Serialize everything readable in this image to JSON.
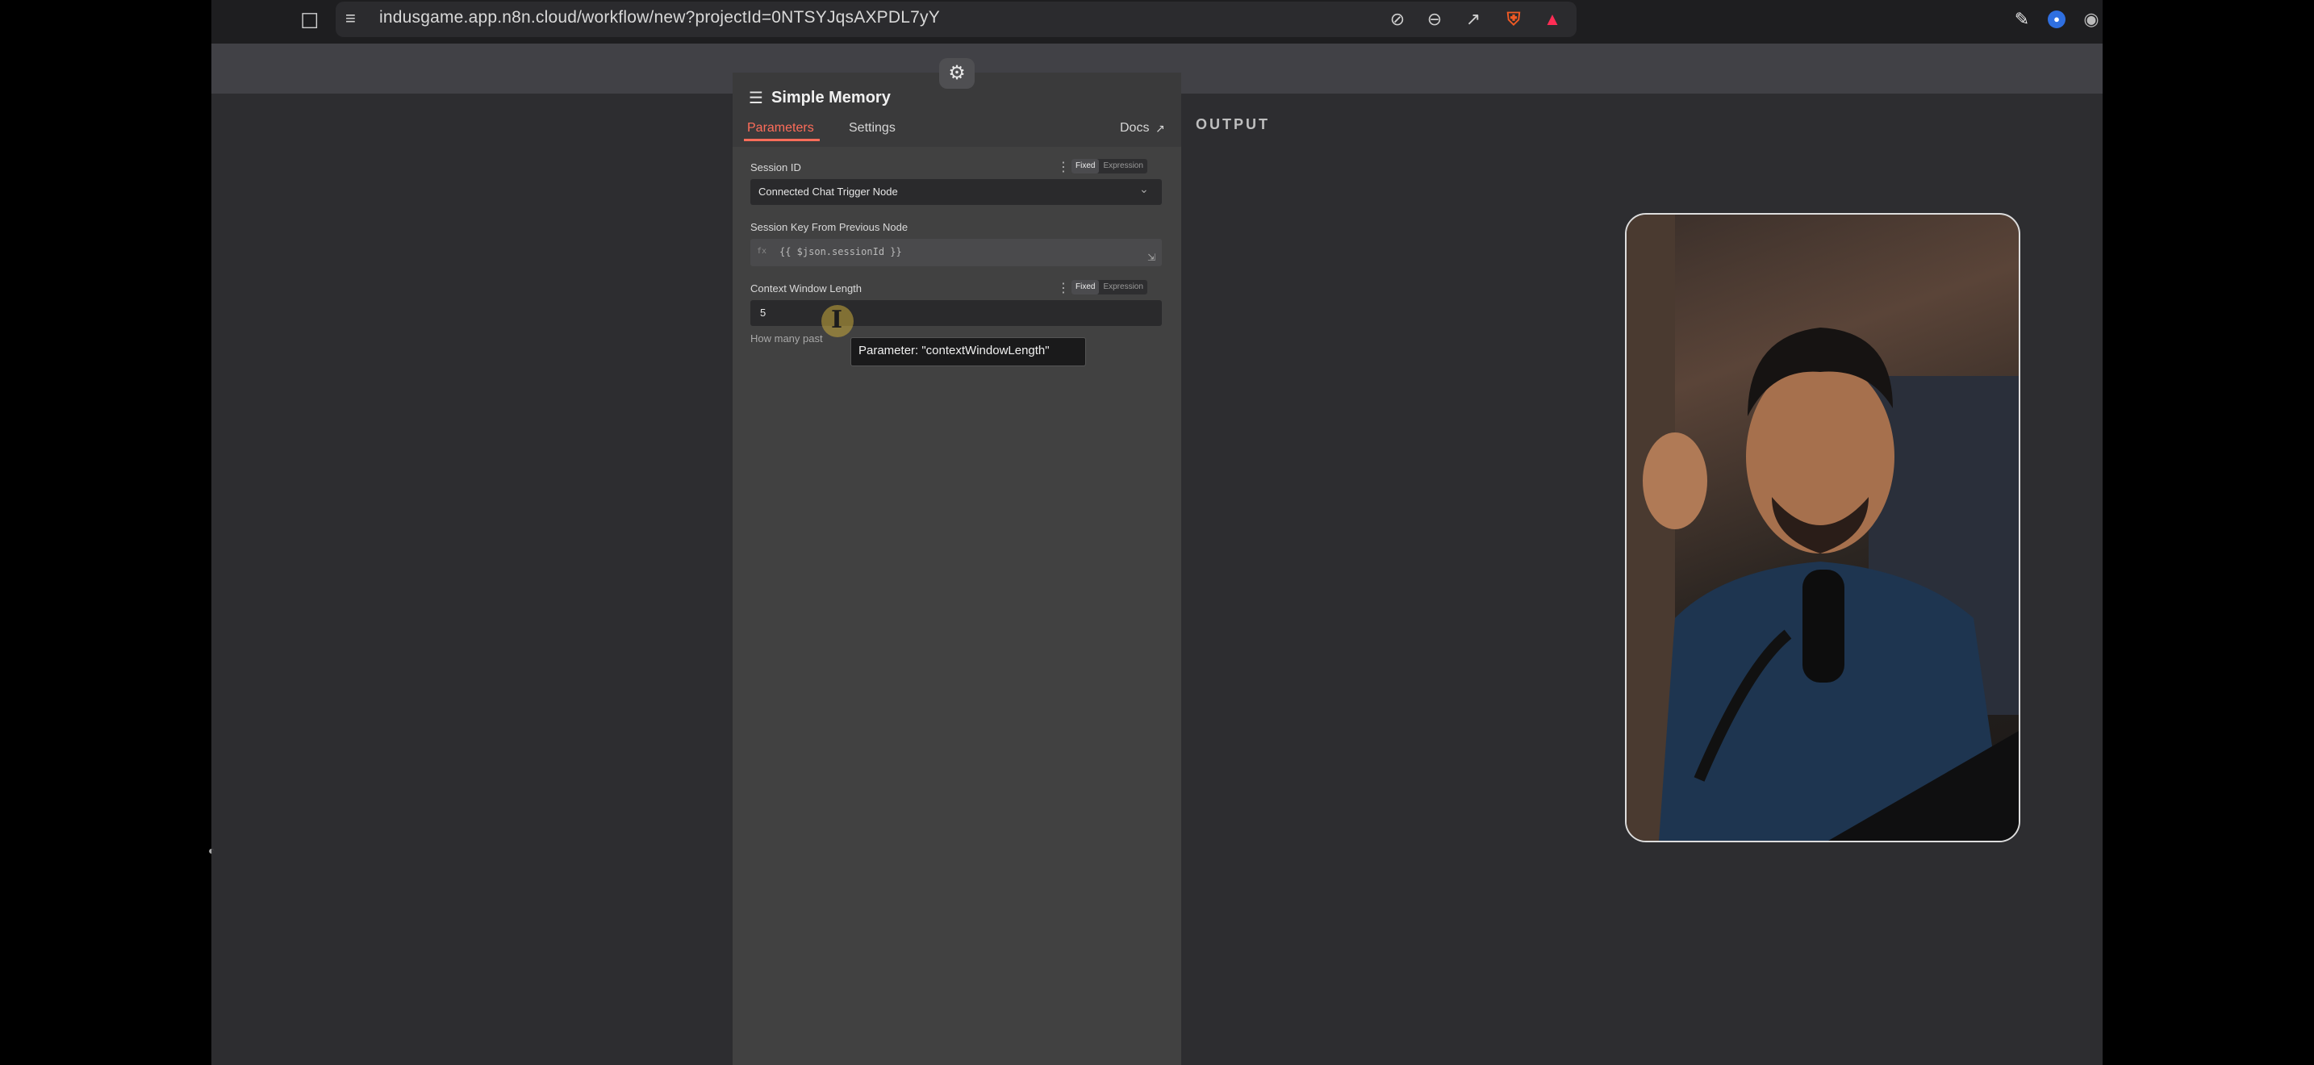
{
  "browser": {
    "url": "indusgame.app.n8n.cloud/workflow/new?projectId=0NTSYJqsAXPDL7yY",
    "icons": [
      "bookmark-icon",
      "site-settings-icon",
      "tracking-off-icon",
      "zoom-out-icon",
      "share-icon",
      "brave-shield-icon",
      "brave-rewards-icon",
      "pen-icon",
      "extension-icon",
      "camera-icon"
    ]
  },
  "panel": {
    "title": "Simple Memory",
    "tabs": {
      "parameters": "Parameters",
      "settings": "Settings"
    },
    "docs": "Docs",
    "session_id": {
      "label": "Session ID",
      "mode_fixed": "Fixed",
      "mode_expression": "Expression",
      "value": "Connected Chat Trigger Node"
    },
    "session_key": {
      "label": "Session Key From Previous Node",
      "prefix": "fx",
      "value": "{{ $json.sessionId }}"
    },
    "context_window": {
      "label": "Context Window Length",
      "mode_fixed": "Fixed",
      "mode_expression": "Expression",
      "value": "5",
      "hint": "How many past"
    },
    "tooltip": "Parameter: \"contextWindowLength\""
  },
  "output": {
    "title": "OUTPUT"
  },
  "colors": {
    "accent": "#ff6d5a",
    "panel": "#414141",
    "canvas": "#2d2d30"
  }
}
